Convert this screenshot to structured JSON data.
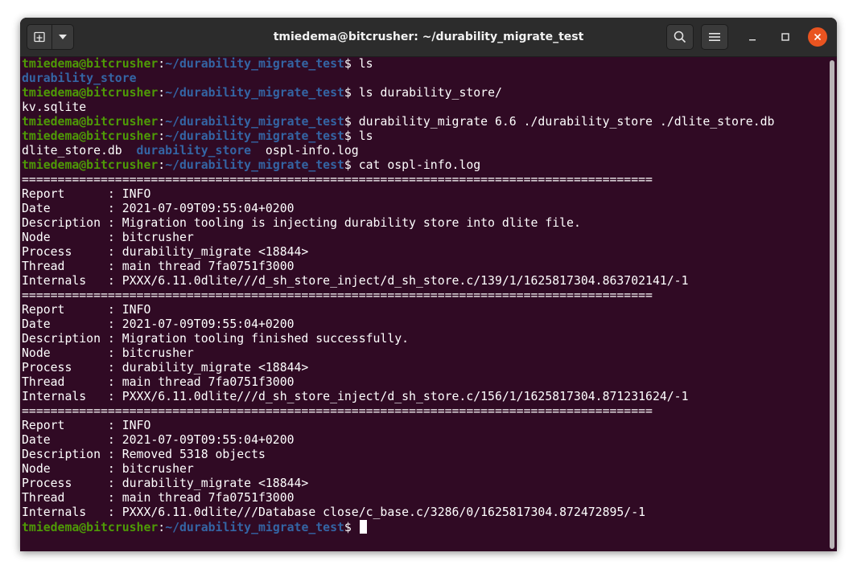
{
  "window": {
    "title": "tmiedema@bitcrusher: ~/durability_migrate_test"
  },
  "icons": {
    "new_tab": "new-tab-icon",
    "dropdown": "chevron-down-icon",
    "search": "search-icon",
    "menu": "hamburger-menu-icon",
    "minimize": "minimize-icon",
    "maximize": "maximize-icon",
    "close": "close-icon"
  },
  "colors": {
    "background": "#300a24",
    "user_host": "#4e9a06",
    "path": "#3465a4",
    "directory": "#3465a4",
    "text": "#ffffff",
    "close_button": "#e95420"
  },
  "terminal": {
    "lines": [
      {
        "user": "tmiedema@bitcrusher",
        "sep": ":",
        "path": "~/durability_migrate_test",
        "cmd": "$ ls"
      },
      {
        "dir": "durability_store"
      },
      {
        "user": "tmiedema@bitcrusher",
        "sep": ":",
        "path": "~/durability_migrate_test",
        "cmd": "$ ls durability_store/"
      },
      {
        "text": "kv.sqlite"
      },
      {
        "user": "tmiedema@bitcrusher",
        "sep": ":",
        "path": "~/durability_migrate_test",
        "cmd": "$ durability_migrate 6.6 ./durability_store ./dlite_store.db"
      },
      {
        "user": "tmiedema@bitcrusher",
        "sep": ":",
        "path": "~/durability_migrate_test",
        "cmd": "$ ls"
      },
      {
        "text": "dlite_store.db  ",
        "dir": "durability_store",
        "after": "  ospl-info.log"
      },
      {
        "user": "tmiedema@bitcrusher",
        "sep": ":",
        "path": "~/durability_migrate_test",
        "cmd": "$ cat ospl-info.log"
      },
      {
        "text": "========================================================================================"
      },
      {
        "text": "Report      : INFO"
      },
      {
        "text": "Date        : 2021-07-09T09:55:04+0200"
      },
      {
        "text": "Description : Migration tooling is injecting durability store into dlite file."
      },
      {
        "text": "Node        : bitcrusher"
      },
      {
        "text": "Process     : durability_migrate <18844>"
      },
      {
        "text": "Thread      : main thread 7fa0751f3000"
      },
      {
        "text": "Internals   : PXXX/6.11.0dlite///d_sh_store_inject/d_sh_store.c/139/1/1625817304.863702141/-1"
      },
      {
        "text": "========================================================================================"
      },
      {
        "text": "Report      : INFO"
      },
      {
        "text": "Date        : 2021-07-09T09:55:04+0200"
      },
      {
        "text": "Description : Migration tooling finished successfully."
      },
      {
        "text": "Node        : bitcrusher"
      },
      {
        "text": "Process     : durability_migrate <18844>"
      },
      {
        "text": "Thread      : main thread 7fa0751f3000"
      },
      {
        "text": "Internals   : PXXX/6.11.0dlite///d_sh_store_inject/d_sh_store.c/156/1/1625817304.871231624/-1"
      },
      {
        "text": "========================================================================================"
      },
      {
        "text": "Report      : INFO"
      },
      {
        "text": "Date        : 2021-07-09T09:55:04+0200"
      },
      {
        "text": "Description : Removed 5318 objects"
      },
      {
        "text": "Node        : bitcrusher"
      },
      {
        "text": "Process     : durability_migrate <18844>"
      },
      {
        "text": "Thread      : main thread 7fa0751f3000"
      },
      {
        "text": "Internals   : PXXX/6.11.0dlite///Database close/c_base.c/3286/0/1625817304.872472895/-1"
      },
      {
        "user": "tmiedema@bitcrusher",
        "sep": ":",
        "path": "~/durability_migrate_test",
        "cmd": "$ ",
        "cursor": true
      }
    ]
  }
}
